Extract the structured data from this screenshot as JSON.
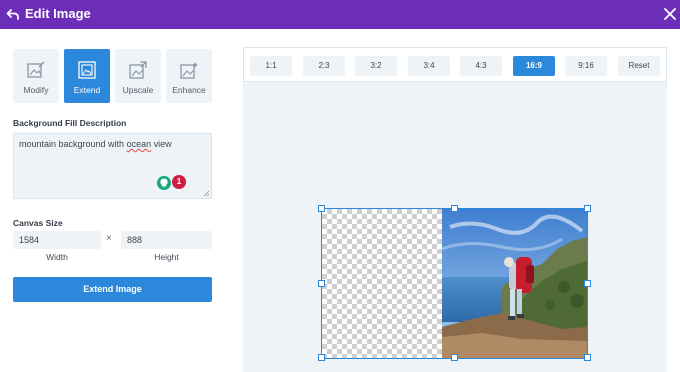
{
  "header": {
    "title": "Edit Image",
    "back_icon": "back-arrow-icon",
    "close_icon": "close-icon",
    "background": "#6c2eb9"
  },
  "tools": [
    {
      "label": "Modify",
      "icon": "image-edit-icon",
      "active": false
    },
    {
      "label": "Extend",
      "icon": "image-extend-icon",
      "active": true
    },
    {
      "label": "Upscale",
      "icon": "image-upscale-icon",
      "active": false
    },
    {
      "label": "Enhance",
      "icon": "image-enhance-icon",
      "active": false
    }
  ],
  "background_fill": {
    "label": "Background Fill Description",
    "value_before": "mountain background with ",
    "value_misspelled": "ocean",
    "value_after": " view",
    "grammar_issue_count": "1"
  },
  "canvas_size": {
    "label": "Canvas Size",
    "width_value": "1584",
    "height_value": "888",
    "separator": "×",
    "width_caption": "Width",
    "height_caption": "Height"
  },
  "extend_button": "Extend Image",
  "aspect_ratios": [
    {
      "label": "1:1",
      "active": false
    },
    {
      "label": "2:3",
      "active": false
    },
    {
      "label": "3:2",
      "active": false
    },
    {
      "label": "3:4",
      "active": false
    },
    {
      "label": "4:3",
      "active": false
    },
    {
      "label": "16:9",
      "active": true
    },
    {
      "label": "9:16",
      "active": false
    },
    {
      "label": "Reset",
      "active": false
    }
  ],
  "colors": {
    "accent": "#2c88da",
    "panel": "#eef3f8",
    "error": "#d11d43",
    "grammar": "#15a87a"
  }
}
